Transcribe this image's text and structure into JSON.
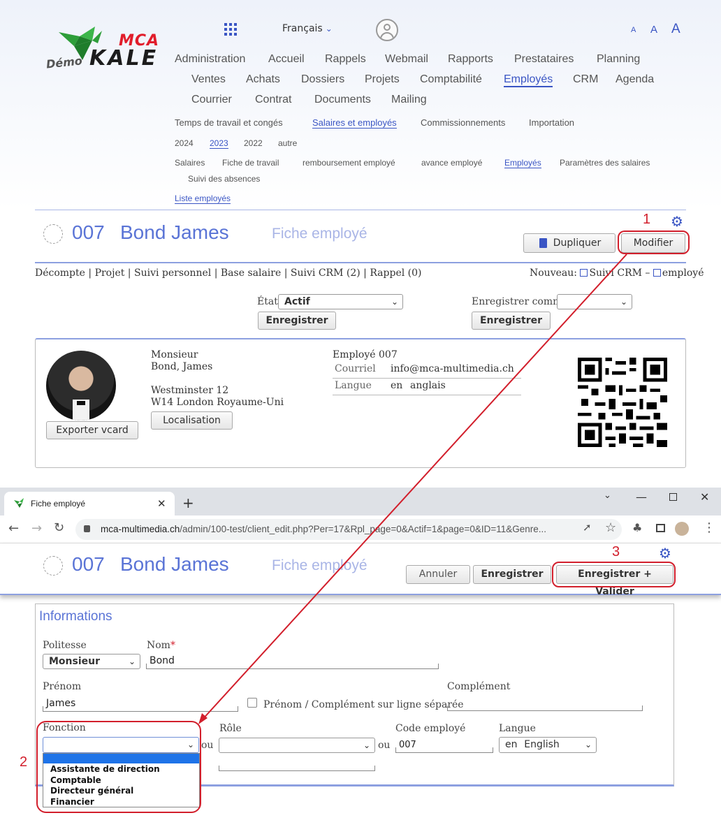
{
  "logo": {
    "mca": "MCA",
    "kale": "KALE",
    "demo": "Démo"
  },
  "header": {
    "language": "Français",
    "font_sizes": [
      "A",
      "A",
      "A"
    ]
  },
  "main_nav": {
    "row1": [
      "Administration",
      "Accueil",
      "Rappels",
      "Webmail",
      "Rapports",
      "Prestataires",
      "Planning"
    ],
    "row2": [
      "Ventes",
      "Achats",
      "Dossiers",
      "Projets",
      "Comptabilité",
      "Employés",
      "CRM",
      "Agenda"
    ],
    "row3": [
      "Courrier",
      "Contrat",
      "Documents",
      "Mailing"
    ],
    "active": "Employés"
  },
  "sub_nav": {
    "items": [
      "Temps de travail et congés",
      "Salaires et employés",
      "Commissionnements",
      "Importation"
    ],
    "active": "Salaires et employés"
  },
  "years": {
    "items": [
      "2024",
      "2023",
      "2022",
      "autre"
    ],
    "active": "2023"
  },
  "sub_nav3": {
    "items": [
      "Salaires",
      "Fiche de travail",
      "remboursement employé",
      "avance employé",
      "Employés",
      "Paramètres des salaires",
      "Suivi des absences"
    ],
    "active": "Employés"
  },
  "sub_nav4": {
    "item": "Liste employés"
  },
  "record": {
    "number": "007",
    "name": "Bond James",
    "subtitle": "Fiche employé"
  },
  "actions": {
    "duplicate": "Dupliquer",
    "modify": "Modifier"
  },
  "annotations": {
    "n1": "1",
    "n2": "2",
    "n3": "3"
  },
  "links": {
    "items": [
      "Décompte",
      "Projet",
      "Suivi personnel",
      "Base salaire",
      "Suivi CRM (2)",
      "Rappel (0)"
    ],
    "separator": " | ",
    "new_label": "Nouveau:",
    "new_crm": "Suivi CRM",
    "new_dash": "–",
    "new_employee": "employé"
  },
  "state": {
    "label": "État",
    "value": "Actif",
    "save": "Enregistrer",
    "save_as_label": "Enregistrer comme",
    "save_as_value": "",
    "save2": "Enregistrer"
  },
  "card": {
    "title": "Monsieur",
    "name": "Bond, James",
    "address1": "Westminster 12",
    "address2": "W14 London Royaume-Uni",
    "localisation": "Localisation",
    "export": "Exporter vcard",
    "employee": "Employé 007",
    "email_label": "Courriel",
    "email": "info@mca-multimedia.ch",
    "lang_label": "Langue",
    "lang_code": "en",
    "lang_name": "anglais"
  },
  "browser": {
    "tab_title": "Fiche employé",
    "url_domain": "mca-multimedia.ch",
    "url_path": "/admin/100-test/client_edit.php?Per=17&Rpl_page=0&Actif=1&page=0&ID=11&Genre..."
  },
  "edit": {
    "number": "007",
    "name": "Bond James",
    "subtitle": "Fiche employé",
    "cancel": "Annuler",
    "save": "Enregistrer",
    "save_validate": "Enregistrer + Valider"
  },
  "form": {
    "section_title": "Informations",
    "politesse_label": "Politesse",
    "politesse_value": "Monsieur",
    "nom_label": "Nom",
    "nom_required": "*",
    "nom_value": "Bond",
    "prenom_label": "Prénom",
    "prenom_value": "James",
    "separate_label": "Prénom / Complément sur ligne séparée",
    "complement_label": "Complément",
    "complement_value": "",
    "fonction_label": "Fonction",
    "fonction_value": "",
    "or1": "ou",
    "role_label": "Rôle",
    "role_value": "",
    "or2": "ou",
    "code_label": "Code employé",
    "code_value": "007",
    "langue_label": "Langue",
    "langue_code": "en",
    "langue_value": "English",
    "fonction_options": [
      "",
      "Assistante de direction",
      "Comptable",
      "Directeur général",
      "Financier"
    ]
  },
  "colors": {
    "accent": "#3a55c4",
    "title": "#5a74d6",
    "annotation": "#d21f2c"
  }
}
